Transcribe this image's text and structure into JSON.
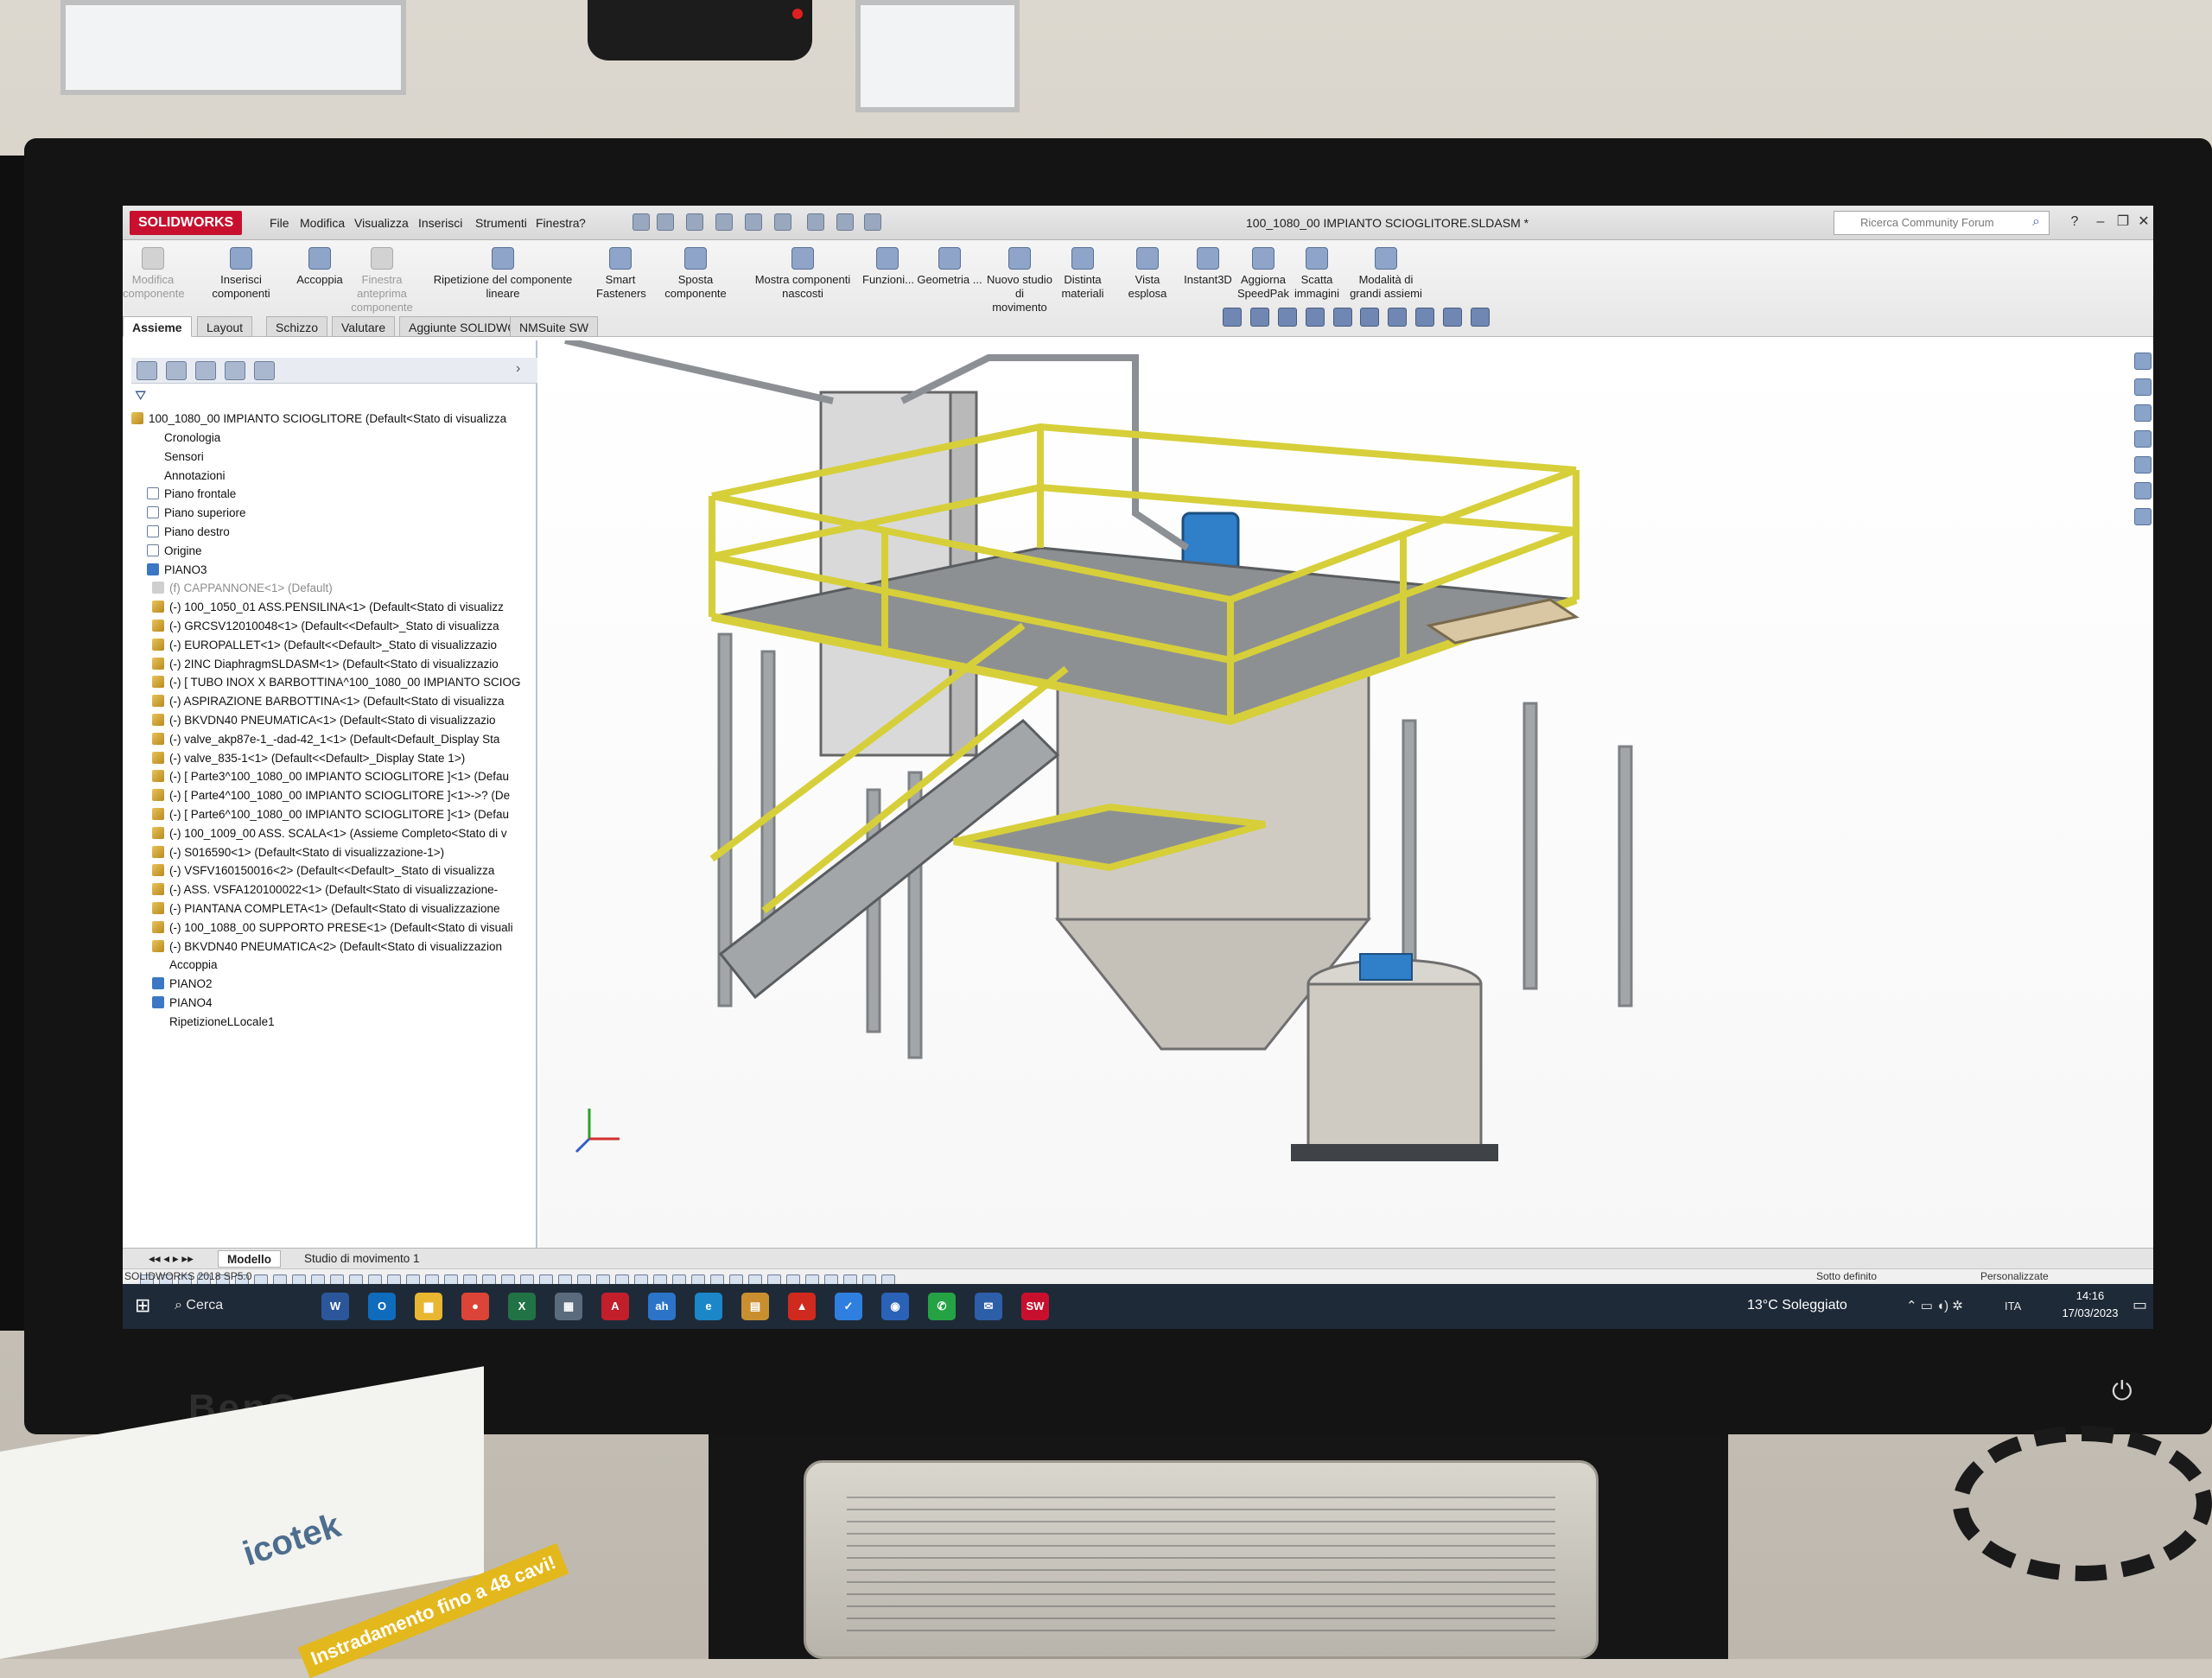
{
  "app": {
    "logo": "SOLIDWORKS",
    "doc_title": "100_1080_00 IMPIANTO SCIOGLITORE.SLDASM *"
  },
  "menu": [
    "File",
    "Modifica",
    "Visualizza",
    "Inserisci",
    "Strumenti",
    "Finestra",
    "?"
  ],
  "search": {
    "placeholder": "Ricerca Community Forum"
  },
  "toolbar": [
    {
      "label": "Modifica componente",
      "enabled": false
    },
    {
      "label": "Inserisci componenti",
      "enabled": true
    },
    {
      "label": "Accoppia",
      "enabled": true
    },
    {
      "label": "Finestra anteprima componente",
      "enabled": false
    },
    {
      "label": "Ripetizione del componente lineare",
      "enabled": true
    },
    {
      "label": "Smart Fasteners",
      "enabled": true
    },
    {
      "label": "Sposta componente",
      "enabled": true
    },
    {
      "label": "Mostra componenti nascosti",
      "enabled": true
    },
    {
      "label": "Funzioni...",
      "enabled": true
    },
    {
      "label": "Geometria ...",
      "enabled": true
    },
    {
      "label": "Nuovo studio di movimento",
      "enabled": true
    },
    {
      "label": "Distinta materiali",
      "enabled": true
    },
    {
      "label": "Vista esplosa",
      "enabled": true
    },
    {
      "label": "Instant3D",
      "enabled": true
    },
    {
      "label": "Aggiorna SpeedPak",
      "enabled": true
    },
    {
      "label": "Scatta immagini",
      "enabled": true
    },
    {
      "label": "Modalità di grandi assiemi",
      "enabled": true
    }
  ],
  "tabs": [
    "Assieme",
    "Layout",
    "Schizzo",
    "Valutare",
    "Aggiunte SOLIDWORKS",
    "NMSuite SW"
  ],
  "tree": {
    "root": "100_1080_00 IMPIANTO SCIOGLITORE  (Default<Stato di visualizza",
    "items": [
      {
        "label": "Cronologia",
        "icon": "folder",
        "indent": 1,
        "muted": false
      },
      {
        "label": "Sensori",
        "icon": "folder",
        "indent": 1,
        "muted": false
      },
      {
        "label": "Annotazioni",
        "icon": "folder",
        "indent": 1,
        "muted": false
      },
      {
        "label": "Piano frontale",
        "icon": "plane",
        "indent": 1,
        "muted": false
      },
      {
        "label": "Piano superiore",
        "icon": "plane",
        "indent": 1,
        "muted": false
      },
      {
        "label": "Piano destro",
        "icon": "plane",
        "indent": 1,
        "muted": false
      },
      {
        "label": "Origine",
        "icon": "plane",
        "indent": 1,
        "muted": false
      },
      {
        "label": "PIANO3",
        "icon": "blue",
        "indent": 1,
        "muted": false
      },
      {
        "label": "(f) CAPPANNONE<1> (Default)",
        "icon": "gray",
        "indent": 1,
        "muted": true
      },
      {
        "label": "(-) 100_1050_01 ASS.PENSILINA<1> (Default<Stato di visualizz",
        "icon": "asm",
        "indent": 1,
        "muted": false
      },
      {
        "label": "(-) GRCSV12010048<1> (Default<<Default>_Stato di visualizza",
        "icon": "asm",
        "indent": 1,
        "muted": false
      },
      {
        "label": "(-) EUROPALLET<1> (Default<<Default>_Stato di visualizzazio",
        "icon": "asm",
        "indent": 1,
        "muted": false
      },
      {
        "label": "(-) 2INC DiaphragmSLDASM<1> (Default<Stato di visualizzazio",
        "icon": "asm",
        "indent": 1,
        "muted": false
      },
      {
        "label": "(-) [ TUBO INOX X BARBOTTINA^100_1080_00 IMPIANTO SCIOG",
        "icon": "asm",
        "indent": 1,
        "muted": false
      },
      {
        "label": "(-) ASPIRAZIONE BARBOTTINA<1> (Default<Stato di visualizza",
        "icon": "asm",
        "indent": 1,
        "muted": false
      },
      {
        "label": "(-) BKVDN40 PNEUMATICA<1> (Default<Stato di visualizzazio",
        "icon": "asm",
        "indent": 1,
        "muted": false
      },
      {
        "label": "(-) valve_akp87e-1_-dad-42_1<1> (Default<Default_Display Sta",
        "icon": "asm",
        "indent": 1,
        "muted": false
      },
      {
        "label": "(-) valve_835-1<1> (Default<<Default>_Display State 1>)",
        "icon": "asm",
        "indent": 1,
        "muted": false
      },
      {
        "label": "(-) [ Parte3^100_1080_00 IMPIANTO SCIOGLITORE ]<1> (Defau",
        "icon": "asm",
        "indent": 1,
        "muted": false
      },
      {
        "label": "(-) [ Parte4^100_1080_00 IMPIANTO SCIOGLITORE ]<1>->? (De",
        "icon": "asm",
        "indent": 1,
        "muted": false
      },
      {
        "label": "(-) [ Parte6^100_1080_00 IMPIANTO SCIOGLITORE ]<1> (Defau",
        "icon": "asm",
        "indent": 1,
        "muted": false
      },
      {
        "label": "(-) 100_1009_00 ASS. SCALA<1> (Assieme Completo<Stato di v",
        "icon": "asm",
        "indent": 1,
        "muted": false
      },
      {
        "label": "(-) S016590<1> (Default<Stato di visualizzazione-1>)",
        "icon": "asm",
        "indent": 1,
        "muted": false
      },
      {
        "label": "(-) VSFV160150016<2> (Default<<Default>_Stato di visualizza",
        "icon": "asm",
        "indent": 1,
        "muted": false
      },
      {
        "label": "(-) ASS. VSFA120100022<1> (Default<Stato di visualizzazione-",
        "icon": "asm",
        "indent": 1,
        "muted": false
      },
      {
        "label": "(-) PIANTANA COMPLETA<1> (Default<Stato di visualizzazione",
        "icon": "asm",
        "indent": 1,
        "muted": false
      },
      {
        "label": "(-) 100_1088_00 SUPPORTO PRESE<1> (Default<Stato di visuali",
        "icon": "asm",
        "indent": 1,
        "muted": false
      },
      {
        "label": "(-) BKVDN40 PNEUMATICA<2> (Default<Stato di visualizzazion",
        "icon": "asm",
        "indent": 1,
        "muted": false
      },
      {
        "label": "Accoppia",
        "icon": "folder",
        "indent": 1,
        "muted": false
      },
      {
        "label": "PIANO2",
        "icon": "blue",
        "indent": 1,
        "muted": false
      },
      {
        "label": "PIANO4",
        "icon": "blue",
        "indent": 1,
        "muted": false
      },
      {
        "label": "RipetizioneLLocale1",
        "icon": "folder",
        "indent": 1,
        "muted": false
      }
    ]
  },
  "bottom_tabs": [
    "Modello",
    "Studio di movimento 1"
  ],
  "status": {
    "version": "SOLIDWORKS 2018 SP5.0",
    "definition": "Sotto definito",
    "customize": "Personalizzate"
  },
  "taskbar": {
    "search": "Cerca",
    "apps": [
      {
        "name": "word-icon",
        "text": "W",
        "color": "#2b579a"
      },
      {
        "name": "outlook-icon",
        "text": "O",
        "color": "#0f6cbd"
      },
      {
        "name": "explorer-icon",
        "text": "▆",
        "color": "#e8b630"
      },
      {
        "name": "chrome-icon",
        "text": "●",
        "color": "#db4437"
      },
      {
        "name": "excel-icon",
        "text": "X",
        "color": "#217346"
      },
      {
        "name": "calculator-icon",
        "text": "▦",
        "color": "#5a6b7d"
      },
      {
        "name": "autocad-icon",
        "text": "A",
        "color": "#c21f2b"
      },
      {
        "name": "ah-app-icon",
        "text": "ah",
        "color": "#2b74c8"
      },
      {
        "name": "edge-icon",
        "text": "e",
        "color": "#1b86c8"
      },
      {
        "name": "archive-icon",
        "text": "▤",
        "color": "#c98f2f"
      },
      {
        "name": "acrobat-icon",
        "text": "▲",
        "color": "#d02a1e"
      },
      {
        "name": "todo-icon",
        "text": "✓",
        "color": "#2f7fe0"
      },
      {
        "name": "browser-icon",
        "text": "◉",
        "color": "#2a62b8"
      },
      {
        "name": "whatsapp-icon",
        "text": "✆",
        "color": "#25a244"
      },
      {
        "name": "mail-icon",
        "text": "✉",
        "color": "#2d5ea8"
      },
      {
        "name": "solidworks-icon",
        "text": "SW",
        "color": "#c8102e"
      }
    ],
    "weather": "13°C Soleggiato",
    "lang": "ITA",
    "time": "14:16",
    "date": "17/03/2023"
  },
  "desk": {
    "monitor_brand": "BenQ",
    "booklet_title": "icotek",
    "booklet_tag": "Instradamento fino a 48 cavi!"
  },
  "colors": {
    "railing": "#d6cf3a",
    "steel": "#9a9d9f",
    "motor": "#2f7fc9",
    "cabinet": "#d9d9d9"
  }
}
